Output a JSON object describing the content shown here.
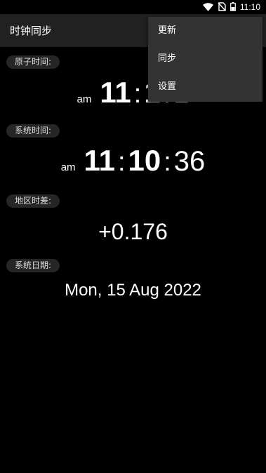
{
  "status_bar": {
    "time": "11:10",
    "icons": [
      "wifi-icon",
      "no-sim-icon",
      "battery-icon"
    ]
  },
  "app_bar": {
    "title": "时钟同步"
  },
  "atomic_time": {
    "label": "原子时间:",
    "ampm": "am",
    "hour": "11",
    "minute": "1",
    "second": "1"
  },
  "system_time": {
    "label": "系统时间:",
    "ampm": "am",
    "hour": "11",
    "minute": "10",
    "second": "36"
  },
  "offset": {
    "label": "地区时差:",
    "value": "+0.176"
  },
  "system_date": {
    "label": "系统日期:",
    "value": "Mon, 15 Aug 2022"
  },
  "overflow_menu": {
    "items": [
      "更新",
      "同步",
      "设置"
    ]
  },
  "colors": {
    "background": "#000000",
    "app_bar": "#212121",
    "menu": "#333333",
    "label_pill": "#262626"
  }
}
